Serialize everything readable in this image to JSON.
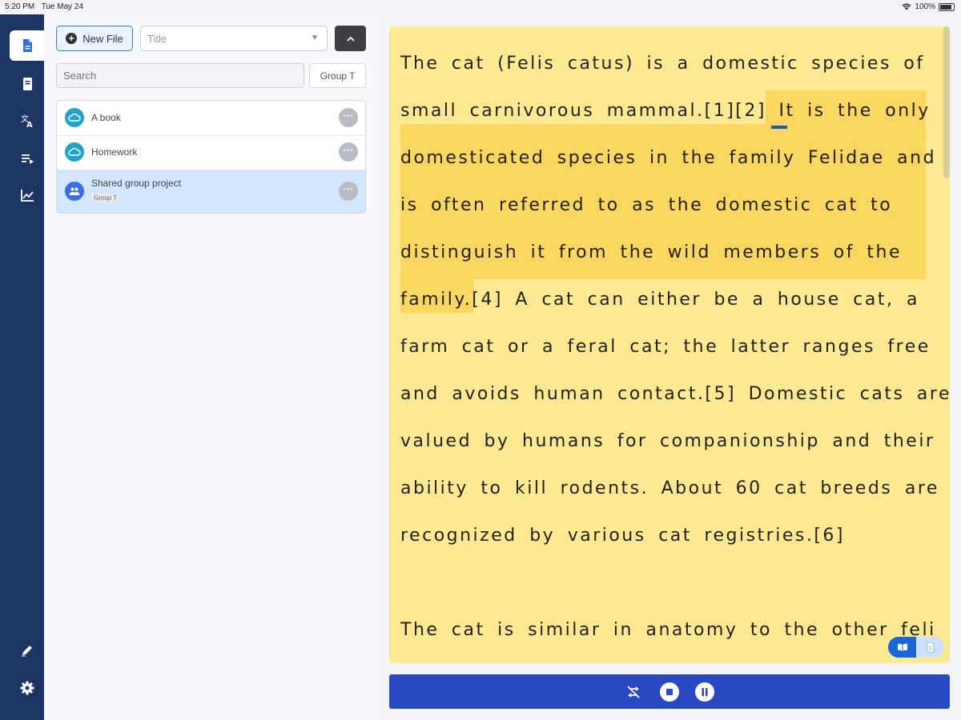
{
  "status_bar": {
    "time": "5:20 PM",
    "date": "Tue May 24",
    "battery": "100%"
  },
  "nav": {
    "items": [
      {
        "name": "documents",
        "icon": "document-icon",
        "active": true
      },
      {
        "name": "library",
        "icon": "book-icon",
        "active": false
      },
      {
        "name": "translate",
        "icon": "translate-icon",
        "active": false
      },
      {
        "name": "playlist",
        "icon": "playlist-icon",
        "active": false
      },
      {
        "name": "statistics",
        "icon": "chart-icon",
        "active": false
      }
    ],
    "bottom_items": [
      {
        "name": "edit",
        "icon": "pencil-icon"
      },
      {
        "name": "settings",
        "icon": "gear-icon"
      }
    ]
  },
  "toolbar": {
    "new_file_label": "New File",
    "sort_value": "Title",
    "collapse_icon": "chevron-up-icon"
  },
  "search": {
    "placeholder": "Search"
  },
  "group_button_label": "Group T",
  "files": [
    {
      "name": "A book",
      "icon": "cloud-icon",
      "badge": ""
    },
    {
      "name": "Homework",
      "icon": "cloud-icon",
      "badge": ""
    },
    {
      "name": "Shared group project",
      "icon": "group-icon",
      "badge": "Group T"
    }
  ],
  "reader": {
    "text": "The cat (Felis catus) is a domestic species of\nsmall carnivorous mammal.[1][2] It is the only\ndomesticated species in the family Felidae and\nis often referred to as the domestic cat to\ndistinguish it from the wild members of the\nfamily.[4] A cat can either be a house cat, a\nfarm cat or a feral cat; the latter ranges free\nand avoids human contact.[5] Domestic cats are\nvalued by humans for companionship and their\nability to kill rodents. About 60 cat breeds are\nrecognized by various cat registries.[6]\n\nThe cat is similar in anatomy to the other feli",
    "background_color": "#fde991",
    "highlight_color": "#fbd660"
  },
  "colors": {
    "nav_bg": "#1d3464",
    "accent": "#2949c0",
    "selected_row": "#d4e6ff"
  }
}
